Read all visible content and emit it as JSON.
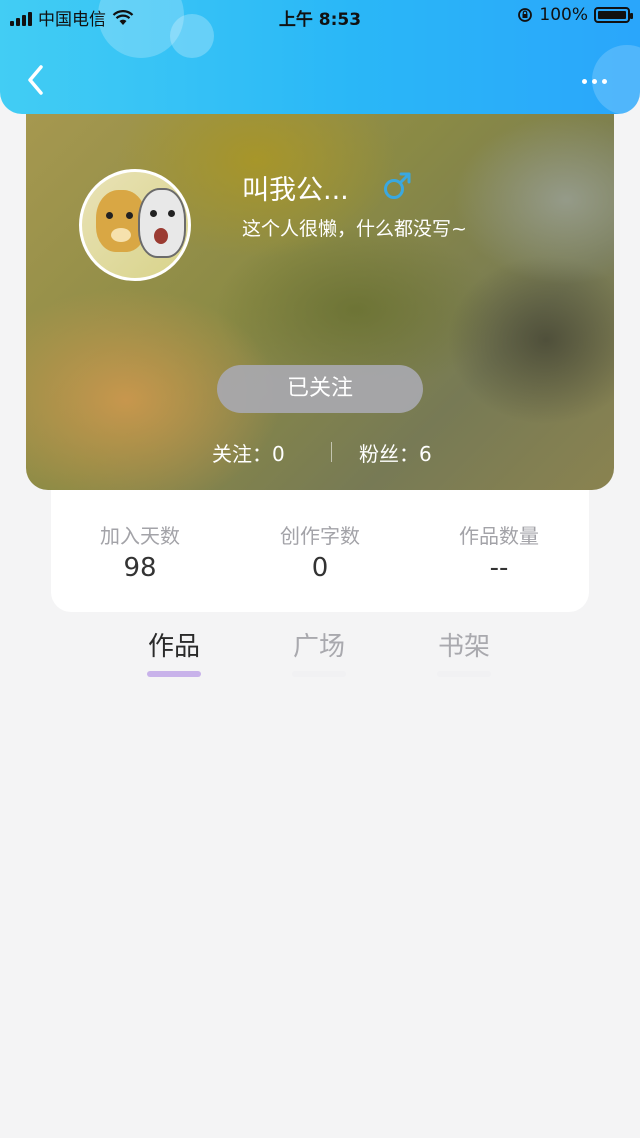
{
  "status_bar": {
    "carrier": "中国电信",
    "time": "上午 8:53",
    "battery": "100%",
    "battery_level": 1.0
  },
  "header": {
    "back_icon": "chevron-left-icon",
    "more_icon": "more-dots-icon",
    "background_colors": [
      "#42cdf4",
      "#2aa6fb"
    ]
  },
  "profile": {
    "username": "叫我公...",
    "gender_icon": "male-symbol-icon",
    "gender_color": "#3aa8e0",
    "bio": "这个人很懒，什么都没写~",
    "follow_button": "已关注",
    "following_label": "关注：0",
    "followers_label": "粉丝：6"
  },
  "stats": [
    {
      "label": "加入天数",
      "value": "98"
    },
    {
      "label": "创作字数",
      "value": "0"
    },
    {
      "label": "作品数量",
      "value": "--"
    }
  ],
  "tabs": [
    {
      "label": "作品",
      "active": true
    },
    {
      "label": "广场",
      "active": false
    },
    {
      "label": "书架",
      "active": false
    }
  ],
  "colors": {
    "accent_tab_bar": "#c8b2ea",
    "page_background": "#f4f4f5"
  }
}
